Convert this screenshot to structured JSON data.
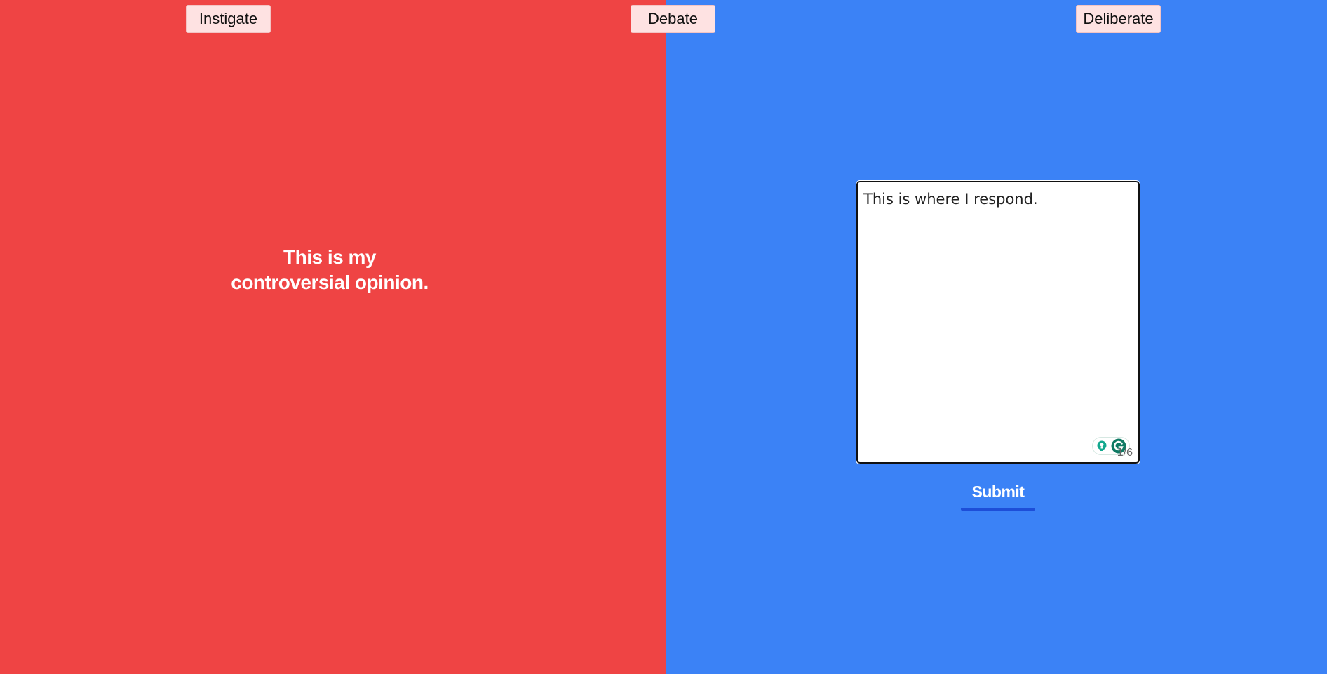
{
  "nav": {
    "instigate_label": "Instigate",
    "debate_label": "Debate",
    "deliberate_label": "Deliberate"
  },
  "opinion": {
    "line1": "This is my",
    "line2": "controversial opinion."
  },
  "response": {
    "value": "This is where I respond.",
    "counter": "1/6"
  },
  "submit_label": "Submit",
  "colors": {
    "left_panel": "#ef4444",
    "right_panel": "#3b82f6",
    "nav_button": "#fee2e2",
    "submit_underline": "#1d4ed8"
  },
  "icons": {
    "grammar_widget": [
      "lightbulb-icon",
      "grammarly-icon"
    ]
  }
}
